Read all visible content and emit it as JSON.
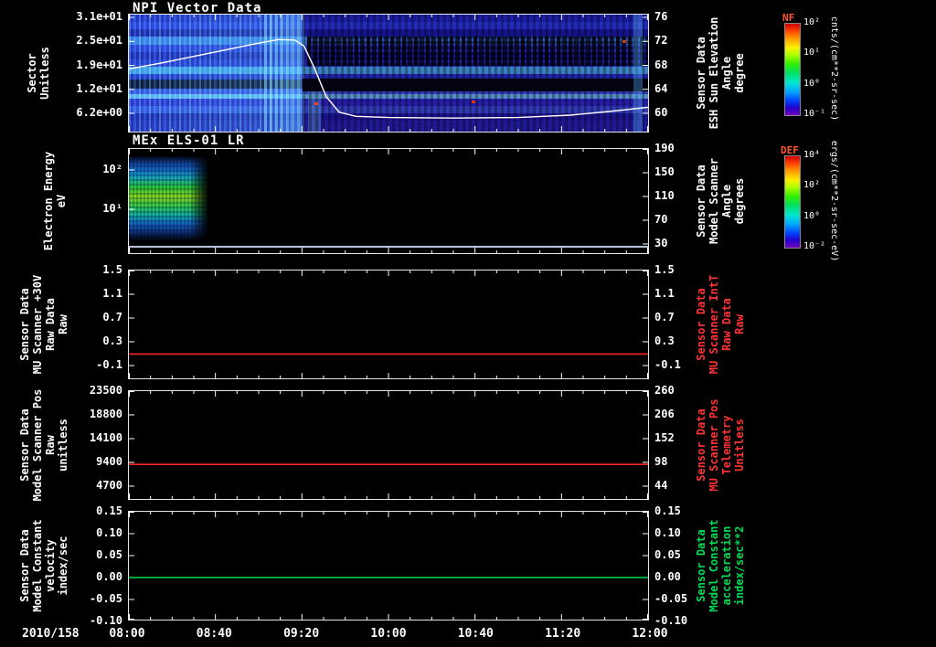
{
  "colors": {
    "background": "#000000",
    "axis": "#ffffff",
    "red_series": "#ff2222",
    "green_series": "#00cc44",
    "red_label": "#ff3333",
    "green_label": "#00dd55",
    "colorbar_title": "#ff5533"
  },
  "xaxis": {
    "date_label": "2010/158",
    "tick_labels": [
      "08:00",
      "08:40",
      "09:20",
      "10:00",
      "10:40",
      "11:20",
      "12:00"
    ]
  },
  "panels": {
    "p1": {
      "title": "NPI Vector Data",
      "left_label_lines": [
        "Sector",
        "Unitless"
      ],
      "left_ticks": [
        "3.1e+01",
        "2.5e+01",
        "1.9e+01",
        "1.2e+01",
        "6.2e+00"
      ],
      "right_ticks": [
        "76",
        "72",
        "68",
        "64",
        "60"
      ],
      "right_label_lines": [
        "Sensor Data",
        "ESH Sun Elevation",
        "Angle",
        "degree"
      ],
      "colorbar": {
        "title": "NF",
        "tick_labels": [
          "10²",
          "10¹",
          "10⁰",
          "10⁻¹"
        ],
        "units": "cnts/(cm**2-sr-sec)"
      }
    },
    "p2": {
      "title": "MEx ELS-01 LR",
      "left_label_lines": [
        "Electron Energy",
        "eV"
      ],
      "left_ticks": [
        "10²",
        "10¹"
      ],
      "right_ticks": [
        "190",
        "150",
        "110",
        "70",
        "30"
      ],
      "right_label_lines": [
        "Sensor Data",
        "Model Scanner",
        "Angle",
        "degrees"
      ],
      "colorbar": {
        "title": "DEF",
        "tick_labels": [
          "10⁴",
          "10²",
          "10⁰",
          "10⁻²"
        ],
        "units": "ergs/(cm**2-sr-sec-eV)"
      }
    },
    "p3": {
      "left_label_lines": [
        "Sensor Data",
        "MU Scanner +30V",
        "Raw Data",
        "Raw"
      ],
      "left_ticks": [
        "1.5",
        "1.1",
        "0.7",
        "0.3",
        "-0.1"
      ],
      "right_ticks": [
        "1.5",
        "1.1",
        "0.7",
        "0.3",
        "-0.1"
      ],
      "right_label_lines": [
        "Sensor Data",
        "MU Scanner IntT",
        "Raw Data",
        "Raw"
      ]
    },
    "p4": {
      "left_label_lines": [
        "Sensor Data",
        "Model Scanner Pos",
        "Raw",
        "unitless"
      ],
      "left_ticks": [
        "23500",
        "18800",
        "14100",
        "9400",
        "4700"
      ],
      "right_ticks": [
        "260",
        "206",
        "152",
        "98",
        "44"
      ],
      "right_label_lines": [
        "Sensor Data",
        "MU Scanner Pos",
        "Telemetry",
        "Unitless"
      ]
    },
    "p5": {
      "left_label_lines": [
        "Sensor Data",
        "Model Constant",
        "velocity",
        "index/sec"
      ],
      "left_ticks": [
        "0.15",
        "0.10",
        "0.05",
        "0.00",
        "-0.05",
        "-0.10"
      ],
      "right_ticks": [
        "0.15",
        "0.10",
        "0.05",
        "0.00",
        "-0.05",
        "-0.10"
      ],
      "right_label_lines": [
        "Sensor Data",
        "Model Constant",
        "acceleration",
        "index/sec**2"
      ]
    }
  },
  "chart_data": {
    "type": "multi-panel-time-series",
    "x": {
      "date": "2010/158",
      "start_hours": 8.0,
      "end_hours": 12.0,
      "tick_labels": [
        "08:00",
        "08:40",
        "09:20",
        "10:00",
        "10:40",
        "11:20",
        "12:00"
      ]
    },
    "panels": {
      "p1": {
        "type": "heatmap",
        "title": "NPI Vector Data",
        "ylabel": "Sector (Unitless)",
        "yticks": [
          31,
          25,
          19,
          12,
          6.2
        ],
        "value_units": "cnts/(cm**2-sr-sec)",
        "color_range": [
          "1e2",
          "1e-1"
        ],
        "description": "Sector-vs-time count spectrogram: bright cyan vertical striping 08:00-09:20, dimmer blue/purple with black speckled sector bands 09:20-12:00; solid black band near sectors 12-14 across the interval",
        "line": {
          "name": "ESH Sun Elevation Angle",
          "units": "degree",
          "color": "#ffffff",
          "ylim": [
            76.46,
            56.95
          ],
          "points": [
            [
              8.0,
              67.4
            ],
            [
              8.25,
              68.4
            ],
            [
              8.5,
              69.5
            ],
            [
              8.75,
              70.6
            ],
            [
              9.0,
              71.7
            ],
            [
              9.15,
              72.3
            ],
            [
              9.28,
              72.2
            ],
            [
              9.35,
              71.2
            ],
            [
              9.43,
              67.5
            ],
            [
              9.52,
              62.8
            ],
            [
              9.62,
              60.2
            ],
            [
              9.75,
              59.5
            ],
            [
              10.0,
              59.3
            ],
            [
              10.5,
              59.2
            ],
            [
              11.0,
              59.3
            ],
            [
              11.4,
              59.7
            ],
            [
              11.7,
              60.3
            ],
            [
              12.0,
              61.0
            ]
          ]
        }
      },
      "p2": {
        "type": "heatmap",
        "title": "MEx ELS-01 LR",
        "ylabel": "Electron Energy (eV)",
        "yscale": "log",
        "yticks": [
          100,
          10
        ],
        "value_units": "ergs/(cm**2-sr-sec-eV)",
        "description": "Electron energy-time spectrogram: bright green/cyan flux between ~4 and ~150 eV from 08:00 until ~08:37, no data afterwards; thin bright line at the lowest energy bin across the full interval"
      },
      "p3": {
        "type": "line",
        "ylim": [
          1.5,
          -0.32
        ],
        "series": [
          {
            "name": "MU Scanner IntT Raw Data",
            "color": "#ff2222",
            "constant_value": 0.09
          }
        ]
      },
      "p4": {
        "type": "line",
        "ylim": [
          23500,
          2170
        ],
        "series": [
          {
            "name": "MU Scanner Pos Telemetry",
            "color": "#ff2222",
            "constant_value": 9000
          }
        ]
      },
      "p5": {
        "type": "line",
        "ylim": [
          0.15,
          -0.096
        ],
        "series": [
          {
            "name": "Model Constant acceleration",
            "color": "#00cc44",
            "constant_value": 0.0
          }
        ]
      }
    }
  }
}
